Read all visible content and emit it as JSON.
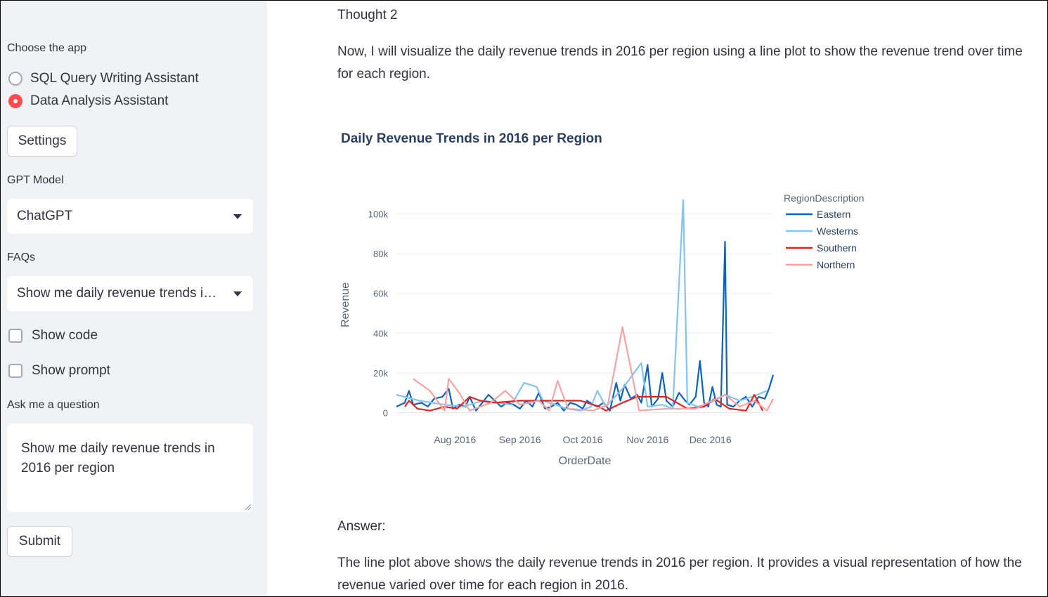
{
  "sidebar": {
    "app_label": "Choose the app",
    "apps": [
      {
        "label": "SQL Query Writing Assistant",
        "selected": false
      },
      {
        "label": "Data Analysis Assistant",
        "selected": true
      }
    ],
    "settings_label": "Settings",
    "model_label": "GPT Model",
    "model_value": "ChatGPT",
    "faqs_label": "FAQs",
    "faq_value": "Show me daily revenue trends in 2016 per region",
    "show_code": "Show code",
    "show_prompt": "Show prompt",
    "question_label": "Ask me a question",
    "question_value": "Show me daily revenue trends in 2016 per region",
    "submit_label": "Submit"
  },
  "main": {
    "thought_heading": "Thought 2",
    "thought_text": "Now, I will visualize the daily revenue trends in 2016 per region using a line plot to show the revenue trend over time for each region.",
    "answer_heading": "Answer:",
    "answer_text": "The line plot above shows the daily revenue trends in 2016 per region. It provides a visual representation of how the revenue varied over time for each region in 2016."
  },
  "colors": {
    "accent": "#ff4b4b",
    "eastern": "#0d62bd",
    "westerns": "#82c5f5",
    "southern": "#e8211e",
    "northern": "#f7a3a3"
  },
  "chart_data": {
    "type": "line",
    "title": "Daily Revenue Trends in 2016 per Region",
    "xlabel": "OrderDate",
    "ylabel": "Revenue",
    "legend_title": "RegionDescription",
    "legend_position": "top-right",
    "grid": true,
    "x_ticks": [
      "Aug 2016",
      "Sep 2016",
      "Oct 2016",
      "Nov 2016",
      "Dec 2016"
    ],
    "y_ticks": [
      "0",
      "20k",
      "40k",
      "60k",
      "80k",
      "100k"
    ],
    "ylim": [
      0,
      110000
    ],
    "xlim": [
      "2016-07-04",
      "2016-12-31"
    ],
    "series": [
      {
        "name": "Eastern",
        "color": "#0d62bd",
        "points": [
          [
            "2016-07-04",
            3000
          ],
          [
            "2016-07-08",
            5000
          ],
          [
            "2016-07-10",
            11000
          ],
          [
            "2016-07-12",
            4000
          ],
          [
            "2016-07-16",
            5000
          ],
          [
            "2016-07-19",
            3000
          ],
          [
            "2016-07-22",
            7000
          ],
          [
            "2016-07-26",
            8000
          ],
          [
            "2016-07-29",
            12000
          ],
          [
            "2016-07-31",
            2000
          ],
          [
            "2016-08-03",
            4000
          ],
          [
            "2016-08-06",
            3000
          ],
          [
            "2016-08-08",
            8000
          ],
          [
            "2016-08-11",
            1000
          ],
          [
            "2016-08-14",
            5000
          ],
          [
            "2016-08-17",
            9000
          ],
          [
            "2016-08-20",
            6000
          ],
          [
            "2016-08-23",
            3000
          ],
          [
            "2016-08-26",
            5000
          ],
          [
            "2016-08-29",
            4000
          ],
          [
            "2016-09-01",
            2000
          ],
          [
            "2016-09-04",
            6000
          ],
          [
            "2016-09-07",
            3000
          ],
          [
            "2016-09-10",
            10000
          ],
          [
            "2016-09-13",
            2000
          ],
          [
            "2016-09-16",
            3000
          ],
          [
            "2016-09-19",
            5000
          ],
          [
            "2016-09-22",
            1000
          ],
          [
            "2016-09-25",
            5000
          ],
          [
            "2016-09-28",
            4000
          ],
          [
            "2016-10-01",
            2000
          ],
          [
            "2016-10-03",
            6000
          ],
          [
            "2016-10-06",
            4000
          ],
          [
            "2016-10-08",
            3000
          ],
          [
            "2016-10-11",
            5000
          ],
          [
            "2016-10-14",
            1000
          ],
          [
            "2016-10-17",
            15000
          ],
          [
            "2016-10-19",
            6000
          ],
          [
            "2016-10-21",
            14000
          ],
          [
            "2016-10-24",
            7000
          ],
          [
            "2016-10-27",
            9000
          ],
          [
            "2016-10-29",
            5000
          ],
          [
            "2016-11-01",
            24000
          ],
          [
            "2016-11-03",
            3000
          ],
          [
            "2016-11-06",
            7000
          ],
          [
            "2016-11-08",
            20000
          ],
          [
            "2016-11-10",
            6000
          ],
          [
            "2016-11-13",
            3000
          ],
          [
            "2016-11-16",
            10000
          ],
          [
            "2016-11-19",
            6000
          ],
          [
            "2016-11-21",
            4000
          ],
          [
            "2016-11-24",
            8000
          ],
          [
            "2016-11-26",
            26000
          ],
          [
            "2016-11-28",
            5000
          ],
          [
            "2016-11-30",
            3000
          ],
          [
            "2016-12-02",
            13000
          ],
          [
            "2016-12-04",
            4000
          ],
          [
            "2016-12-06",
            3000
          ],
          [
            "2016-12-08",
            86000
          ],
          [
            "2016-12-09",
            4000
          ],
          [
            "2016-12-12",
            3000
          ],
          [
            "2016-12-15",
            6000
          ],
          [
            "2016-12-18",
            8000
          ],
          [
            "2016-12-21",
            3000
          ],
          [
            "2016-12-24",
            8000
          ],
          [
            "2016-12-27",
            7000
          ],
          [
            "2016-12-29",
            12000
          ],
          [
            "2016-12-31",
            19000
          ]
        ]
      },
      {
        "name": "Westerns",
        "color": "#82c5f5",
        "points": [
          [
            "2016-07-04",
            9000
          ],
          [
            "2016-07-15",
            6000
          ],
          [
            "2016-07-27",
            4000
          ],
          [
            "2016-08-05",
            3000
          ],
          [
            "2016-08-14",
            6000
          ],
          [
            "2016-08-22",
            5000
          ],
          [
            "2016-08-28",
            4000
          ],
          [
            "2016-09-03",
            15000
          ],
          [
            "2016-09-09",
            13000
          ],
          [
            "2016-09-12",
            6000
          ],
          [
            "2016-09-18",
            4000
          ],
          [
            "2016-09-23",
            2000
          ],
          [
            "2016-09-30",
            1000
          ],
          [
            "2016-10-05",
            3000
          ],
          [
            "2016-10-08",
            11000
          ],
          [
            "2016-10-12",
            3000
          ],
          [
            "2016-10-20",
            12000
          ],
          [
            "2016-10-29",
            25000
          ],
          [
            "2016-11-01",
            3000
          ],
          [
            "2016-11-08",
            4000
          ],
          [
            "2016-11-13",
            2000
          ],
          [
            "2016-11-18",
            107000
          ],
          [
            "2016-11-20",
            5000
          ],
          [
            "2016-11-25",
            3000
          ],
          [
            "2016-12-01",
            5000
          ],
          [
            "2016-12-08",
            9000
          ],
          [
            "2016-12-15",
            6000
          ],
          [
            "2016-12-21",
            8000
          ],
          [
            "2016-12-28",
            11000
          ]
        ]
      },
      {
        "name": "Southern",
        "color": "#e8211e",
        "points": [
          [
            "2016-07-08",
            3000
          ],
          [
            "2016-07-10",
            6000
          ],
          [
            "2016-07-14",
            2000
          ],
          [
            "2016-07-20",
            1000
          ],
          [
            "2016-07-27",
            3000
          ],
          [
            "2016-08-02",
            2000
          ],
          [
            "2016-08-08",
            8000
          ],
          [
            "2016-08-13",
            6000
          ],
          [
            "2016-08-20",
            5000
          ],
          [
            "2016-09-01",
            6000
          ],
          [
            "2016-09-15",
            6000
          ],
          [
            "2016-09-30",
            6000
          ],
          [
            "2016-10-09",
            3000
          ],
          [
            "2016-10-12",
            1000
          ],
          [
            "2016-10-20",
            5000
          ],
          [
            "2016-10-27",
            8000
          ],
          [
            "2016-11-10",
            8000
          ],
          [
            "2016-11-20",
            2000
          ],
          [
            "2016-11-28",
            3000
          ],
          [
            "2016-12-03",
            7000
          ],
          [
            "2016-12-10",
            2000
          ],
          [
            "2016-12-18",
            1000
          ],
          [
            "2016-12-22",
            9000
          ],
          [
            "2016-12-24",
            5000
          ],
          [
            "2016-12-26",
            1000
          ]
        ]
      },
      {
        "name": "Northern",
        "color": "#f7a3a3",
        "points": [
          [
            "2016-07-12",
            17000
          ],
          [
            "2016-07-20",
            11000
          ],
          [
            "2016-07-27",
            1000
          ],
          [
            "2016-07-29",
            17000
          ],
          [
            "2016-08-03",
            10000
          ],
          [
            "2016-08-08",
            1000
          ],
          [
            "2016-08-18",
            5000
          ],
          [
            "2016-08-25",
            11000
          ],
          [
            "2016-09-01",
            4000
          ],
          [
            "2016-09-10",
            6000
          ],
          [
            "2016-09-15",
            1000
          ],
          [
            "2016-09-19",
            16000
          ],
          [
            "2016-09-24",
            2000
          ],
          [
            "2016-10-06",
            1000
          ],
          [
            "2016-10-13",
            4000
          ],
          [
            "2016-10-20",
            43000
          ],
          [
            "2016-10-28",
            1000
          ],
          [
            "2016-11-10",
            2000
          ],
          [
            "2016-11-24",
            2000
          ],
          [
            "2016-12-08",
            9000
          ],
          [
            "2016-12-15",
            3000
          ],
          [
            "2016-12-22",
            6000
          ],
          [
            "2016-12-28",
            1000
          ],
          [
            "2016-12-31",
            7000
          ]
        ]
      }
    ]
  }
}
